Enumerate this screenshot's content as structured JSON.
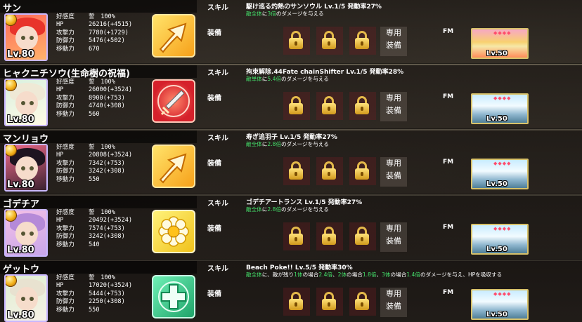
{
  "labels": {
    "skill": "スキル",
    "equip": "装備",
    "exclusive": "専用\n装備",
    "fm": "FM"
  },
  "stat_keys": {
    "affection": "好感度",
    "hp": "HP",
    "attack": "攻撃力",
    "defense": "防御力",
    "move": "移動力"
  },
  "lock_count": 3,
  "characters": [
    {
      "name": "サン",
      "level": "Lv.80",
      "stats": {
        "affection": "誓　100%",
        "hp": "26216(+4515)",
        "attack": "7780(+1729)",
        "defense": "5476(+502)",
        "move": "670"
      },
      "skill": {
        "icon": "arrow-up-icon",
        "title": "駆け巡る灼熱のサンソウル Lv.1/5 発動率27%",
        "desc": [
          {
            "t": "敵全体",
            "g": true
          },
          {
            "t": "に",
            "g": false
          },
          {
            "t": "3倍",
            "g": true
          },
          {
            "t": "のダメージを与える",
            "g": false
          }
        ]
      },
      "equip_level": "Lv.50",
      "equip_art": "sunset"
    },
    {
      "name": "ヒャクニチソウ(生命樹の祝福)",
      "level": "Lv.80",
      "stats": {
        "affection": "誓　100%",
        "hp": "26000(+3524)",
        "attack": "8900(+753)",
        "defense": "4740(+308)",
        "move": "560"
      },
      "skill": {
        "icon": "sword-icon",
        "title": "拘束解除.44Fate chainShifter Lv.1/5 発動率28%",
        "desc": [
          {
            "t": "敵単体",
            "g": true
          },
          {
            "t": "に",
            "g": false
          },
          {
            "t": "5.4倍",
            "g": true
          },
          {
            "t": "のダメージを与える",
            "g": false
          }
        ]
      },
      "equip_level": "Lv.50",
      "equip_art": "glacier"
    },
    {
      "name": "マンリョウ",
      "level": "Lv.80",
      "stats": {
        "affection": "誓　100%",
        "hp": "20808(+3524)",
        "attack": "7342(+753)",
        "defense": "3242(+308)",
        "move": "550"
      },
      "skill": {
        "icon": "arrow-up-icon",
        "title": "寿ぎ追羽子 Lv.1/5 発動率27%",
        "desc": [
          {
            "t": "敵全体",
            "g": true
          },
          {
            "t": "に",
            "g": false
          },
          {
            "t": "2.8倍",
            "g": true
          },
          {
            "t": "のダメージを与える",
            "g": false
          }
        ]
      },
      "equip_level": "Lv.50",
      "equip_art": "glacier"
    },
    {
      "name": "ゴデチア",
      "level": "Lv.80",
      "stats": {
        "affection": "誓　100%",
        "hp": "20492(+3524)",
        "attack": "7574(+753)",
        "defense": "3242(+308)",
        "move": "540"
      },
      "skill": {
        "icon": "flower-icon",
        "title": "ゴデチアートランス Lv.1/5 発動率27%",
        "desc": [
          {
            "t": "敵全体",
            "g": true
          },
          {
            "t": "に",
            "g": false
          },
          {
            "t": "2.8倍",
            "g": true
          },
          {
            "t": "のダメージを与える",
            "g": false
          }
        ]
      },
      "equip_level": "Lv.50",
      "equip_art": "glacier"
    },
    {
      "name": "ゲットウ",
      "level": "Lv.80",
      "stats": {
        "affection": "誓　100%",
        "hp": "17020(+3524)",
        "attack": "5444(+753)",
        "defense": "2250(+308)",
        "move": "550"
      },
      "skill": {
        "icon": "cross-icon",
        "title": "Beach Poke!! Lv.5/5 発動率30%",
        "desc": [
          {
            "t": "敵全体",
            "g": true
          },
          {
            "t": "に、敵が残り",
            "g": false
          },
          {
            "t": "1体",
            "g": true
          },
          {
            "t": "の場合",
            "g": false
          },
          {
            "t": "2.4倍",
            "g": true
          },
          {
            "t": "、",
            "g": false
          },
          {
            "t": "2体",
            "g": true
          },
          {
            "t": "の場合",
            "g": false
          },
          {
            "t": "1.8倍",
            "g": true
          },
          {
            "t": "、",
            "g": false
          },
          {
            "t": "3体",
            "g": true
          },
          {
            "t": "の場合",
            "g": false
          },
          {
            "t": "1.4倍",
            "g": true
          },
          {
            "t": "のダメージを与え、HPを吸収する",
            "g": false
          }
        ]
      },
      "equip_level": "Lv.50",
      "equip_art": "glacier"
    }
  ]
}
